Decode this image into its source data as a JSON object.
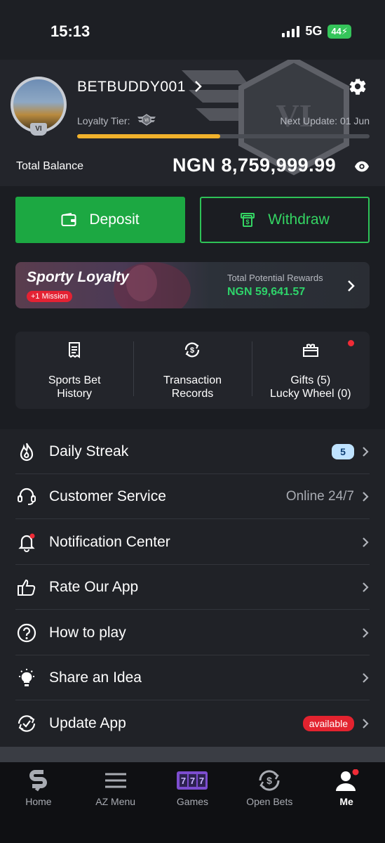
{
  "status_bar": {
    "time": "15:13",
    "network": "5G",
    "battery": "44"
  },
  "profile": {
    "username": "BETBUDDY001",
    "avatar_tier": "VI",
    "loyalty_tier_label": "Loyalty Tier:",
    "next_update": "Next Update: 01 Jun",
    "tier_progress": 0.49
  },
  "balance": {
    "label": "Total Balance",
    "value": "NGN  8,759,999.99"
  },
  "actions": {
    "deposit_label": "Deposit",
    "withdraw_label": "Withdraw"
  },
  "loyalty": {
    "title": "Sporty Loyalty",
    "mission_badge": "+1 Mission",
    "rewards_label": "Total Potential Rewards",
    "rewards_value": "NGN 59,641.57"
  },
  "quick_links": [
    {
      "line1": "Sports Bet",
      "line2": "History",
      "icon": "receipt-icon"
    },
    {
      "line1": "Transaction",
      "line2": "Records",
      "icon": "exchange-icon"
    },
    {
      "line1": "Gifts (5)",
      "line2": "Lucky Wheel (0)",
      "icon": "gift-icon"
    }
  ],
  "menu": [
    {
      "label": "Daily Streak",
      "icon": "flame-icon",
      "badge": "5"
    },
    {
      "label": "Customer Service",
      "icon": "headset-icon",
      "value": "Online 24/7"
    },
    {
      "label": "Notification Center",
      "icon": "bell-icon"
    },
    {
      "label": "Rate Our App",
      "icon": "thumbs-up-icon"
    },
    {
      "label": "How to play",
      "icon": "question-icon"
    },
    {
      "label": "Share an Idea",
      "icon": "lightbulb-icon"
    },
    {
      "label": "Update App",
      "icon": "update-icon",
      "badge": "available"
    }
  ],
  "tabs": [
    {
      "label": "Home",
      "icon": "sporty-logo-icon"
    },
    {
      "label": "AZ Menu",
      "icon": "hamburger-icon"
    },
    {
      "label": "Games",
      "icon": "slots-icon"
    },
    {
      "label": "Open Bets",
      "icon": "open-bets-icon"
    },
    {
      "label": "Me",
      "icon": "user-icon"
    }
  ],
  "colors": {
    "accent_green": "#1ca842",
    "progress": "#f1b22c",
    "alert_red": "#e3232f"
  }
}
